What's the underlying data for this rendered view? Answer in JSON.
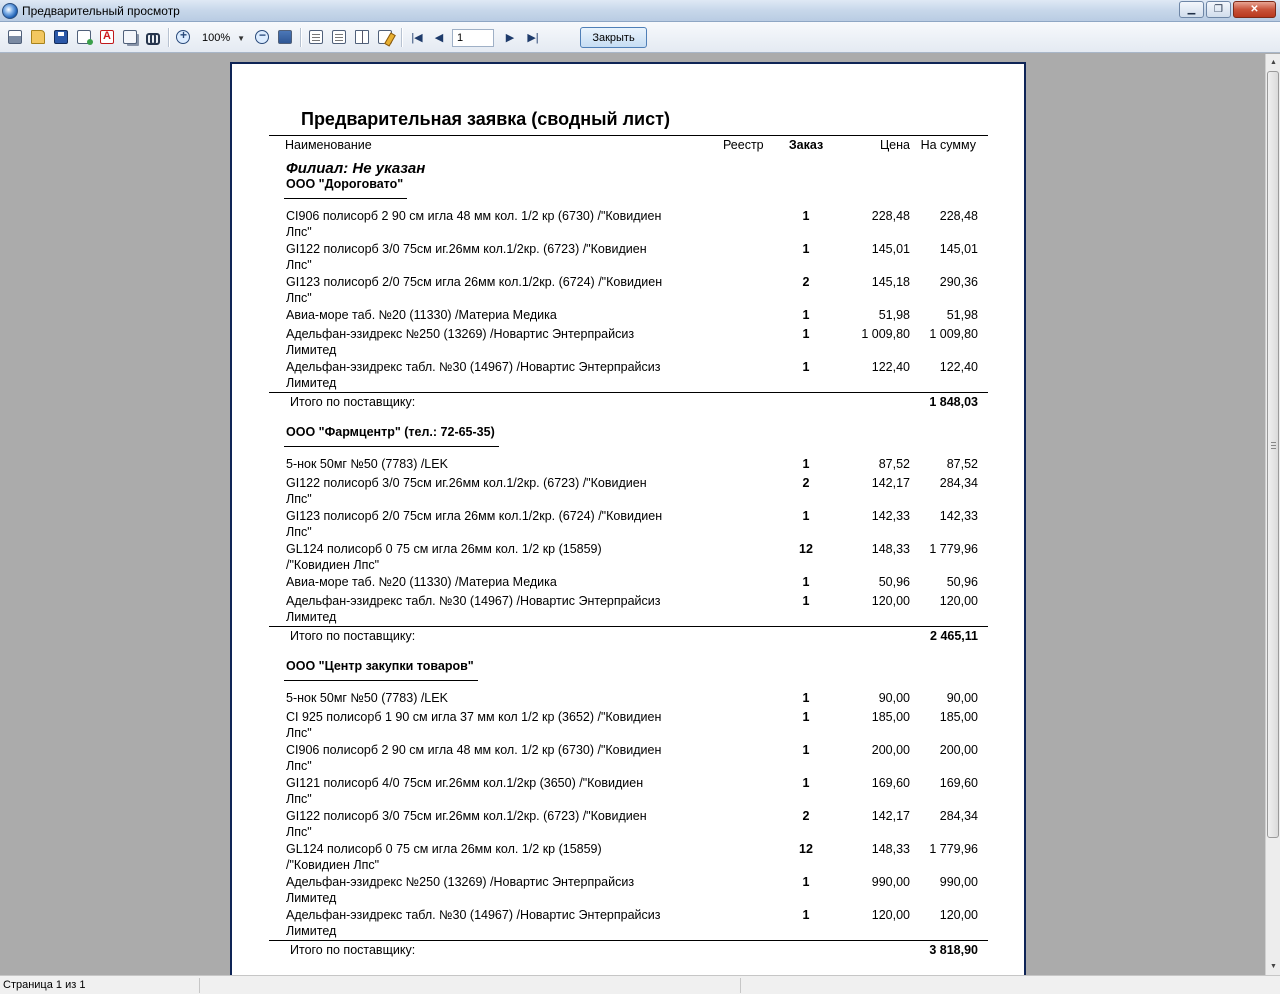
{
  "window": {
    "title": "Предварительный просмотр"
  },
  "toolbar": {
    "zoom": "100%",
    "page_number": "1",
    "close_label": "Закрыть"
  },
  "report": {
    "title": "Предварительная заявка (сводный лист)",
    "columns": {
      "name": "Наименование",
      "registry": "Реестр",
      "order": "Заказ",
      "price": "Цена",
      "sum": "На сумму"
    },
    "branch": "Филиал: Не указан",
    "subtotal_label": "Итого по поставщику:",
    "suppliers": [
      {
        "name": "ООО \"Дороговато\"",
        "total": "1 848,03",
        "items": [
          {
            "name": "CI906 полисорб 2 90 см игла 48 мм кол. 1/2 кр  (6730)   /\"Ковидиен",
            "cont": "Лпс\"",
            "qty": "1",
            "price": "228,48",
            "sum": "228,48"
          },
          {
            "name": "GI122 полисорб 3/0 75см иг.26мм кол.1/2кр.  (6723)   /\"Ковидиен",
            "cont": "Лпс\"",
            "qty": "1",
            "price": "145,01",
            "sum": "145,01"
          },
          {
            "name": "GI123 полисорб 2/0  75см игла 26мм кол.1/2кр.  (6724)   /\"Ковидиен",
            "cont": "Лпс\"",
            "qty": "2",
            "price": "145,18",
            "sum": "290,36"
          },
          {
            "name": "Авиа-море таб. №20  (11330)   /Материа Медика",
            "cont": "",
            "qty": "1",
            "price": "51,98",
            "sum": "51,98"
          },
          {
            "name": "Адельфан-эзидрекс №250  (13269)   /Новартис Энтерпрайсиз",
            "cont": "Лимитед",
            "qty": "1",
            "price": "1 009,80",
            "sum": "1 009,80"
          },
          {
            "name": "Адельфан-эзидрекс табл. №30  (14967)   /Новартис Энтерпрайсиз",
            "cont": "Лимитед",
            "qty": "1",
            "price": "122,40",
            "sum": "122,40"
          }
        ]
      },
      {
        "name": "ООО \"Фармцентр\"  (тел.: 72-65-35)",
        "total": "2 465,11",
        "items": [
          {
            "name": "5-нок 50мг №50  (7783)   /LEK",
            "cont": "",
            "qty": "1",
            "price": "87,52",
            "sum": "87,52"
          },
          {
            "name": "GI122 полисорб 3/0 75см иг.26мм кол.1/2кр.  (6723)   /\"Ковидиен",
            "cont": "Лпс\"",
            "qty": "2",
            "price": "142,17",
            "sum": "284,34"
          },
          {
            "name": "GI123 полисорб 2/0  75см игла 26мм кол.1/2кр.  (6724)   /\"Ковидиен",
            "cont": "Лпс\"",
            "qty": "1",
            "price": "142,33",
            "sum": "142,33"
          },
          {
            "name": "GL124 полисорб 0 75 см игла 26мм кол.  1/2 кр  (15859)",
            "cont": "/\"Ковидиен Лпс\"",
            "qty": "12",
            "price": "148,33",
            "sum": "1 779,96"
          },
          {
            "name": "Авиа-море таб. №20  (11330)   /Материа Медика",
            "cont": "",
            "qty": "1",
            "price": "50,96",
            "sum": "50,96"
          },
          {
            "name": "Адельфан-эзидрекс табл. №30  (14967)   /Новартис Энтерпрайсиз",
            "cont": "Лимитед",
            "qty": "1",
            "price": "120,00",
            "sum": "120,00"
          }
        ]
      },
      {
        "name": "ООО \"Центр закупки товаров\"",
        "total": "3 818,90",
        "items": [
          {
            "name": "5-нок 50мг №50  (7783)   /LEK",
            "cont": "",
            "qty": "1",
            "price": "90,00",
            "sum": "90,00"
          },
          {
            "name": "CI 925 полисорб 1 90 см игла 37 мм кол 1/2 кр  (3652)   /\"Ковидиен",
            "cont": "Лпс\"",
            "qty": "1",
            "price": "185,00",
            "sum": "185,00"
          },
          {
            "name": "CI906 полисорб 2 90 см игла 48 мм кол. 1/2 кр  (6730)   /\"Ковидиен",
            "cont": "Лпс\"",
            "qty": "1",
            "price": "200,00",
            "sum": "200,00"
          },
          {
            "name": "GI121 полисорб 4/0 75см иг.26мм кол.1/2кр  (3650)   /\"Ковидиен",
            "cont": "Лпс\"",
            "qty": "1",
            "price": "169,60",
            "sum": "169,60"
          },
          {
            "name": "GI122 полисорб 3/0 75см иг.26мм кол.1/2кр.  (6723)   /\"Ковидиен",
            "cont": "Лпс\"",
            "qty": "2",
            "price": "142,17",
            "sum": "284,34"
          },
          {
            "name": "GL124 полисорб 0 75 см игла 26мм кол.  1/2 кр  (15859)",
            "cont": "/\"Ковидиен Лпс\"",
            "qty": "12",
            "price": "148,33",
            "sum": "1 779,96"
          },
          {
            "name": "Адельфан-эзидрекс №250  (13269)   /Новартис Энтерпрайсиз",
            "cont": "Лимитед",
            "qty": "1",
            "price": "990,00",
            "sum": "990,00"
          },
          {
            "name": "Адельфан-эзидрекс табл. №30  (14967)   /Новартис Энтерпрайсиз",
            "cont": "Лимитед",
            "qty": "1",
            "price": "120,00",
            "sum": "120,00"
          }
        ]
      }
    ]
  },
  "statusbar": {
    "page_info": "Страница 1 из 1"
  },
  "icons": [
    "print-icon",
    "open-icon",
    "save-icon",
    "export-icon",
    "pdf-icon",
    "copy-icon",
    "find-icon",
    "zoom-in-icon",
    "zoom-out-icon",
    "fit-page-icon",
    "single-page-icon",
    "multi-page-icon",
    "book-icon",
    "edit-icon",
    "first-page-icon",
    "prev-page-icon",
    "next-page-icon",
    "last-page-icon"
  ],
  "colors": {
    "page_border": "#0e2456",
    "workspace": "#ababab",
    "close_accent": "#c9533a"
  }
}
